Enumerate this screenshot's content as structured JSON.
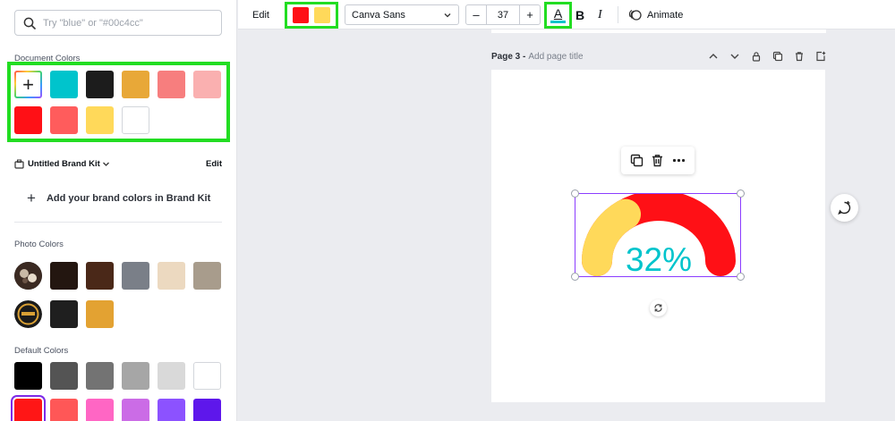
{
  "search": {
    "placeholder": "Try \"blue\" or \"#00c4cc\"",
    "icon": "search-icon"
  },
  "document_colors": {
    "title": "Document Colors",
    "add_icon": "plus-icon",
    "add_label": "+",
    "swatches": [
      "#00c4cc",
      "#1c1c1c",
      "#e8a838",
      "#f77e7e",
      "#fab0b0",
      "#ff1016",
      "#ff5c5c",
      "#ffd95a",
      "#ffffff"
    ]
  },
  "brand_kit": {
    "name": "Untitled Brand Kit",
    "dropdown_icon": "chevron-down-icon",
    "edit_label": "Edit",
    "add_label": "Add your brand colors in Brand Kit"
  },
  "photo_colors": {
    "title": "Photo Colors",
    "photos": [
      "photo-thumbnail-1",
      "photo-thumbnail-2"
    ],
    "row1": [
      "#231610",
      "#4a2818",
      "#7a7f88",
      "#ecd9c0",
      "#a89c8c"
    ],
    "row2": [
      "#1f1f1f",
      "#e3a232"
    ]
  },
  "default_colors": {
    "title": "Default Colors",
    "row1": [
      "#000000",
      "#545454",
      "#737373",
      "#a6a6a6",
      "#d9d9d9",
      "#ffffff"
    ],
    "row2": [
      "#ff1616",
      "#ff5757",
      "#ff66c4",
      "#cb6ce6",
      "#8c52ff",
      "#5e17eb"
    ]
  },
  "toolbar": {
    "edit_label": "Edit",
    "selected_colors": [
      "#ff1016",
      "#ffd95a"
    ],
    "font": "Canva Sans",
    "size_minus": "–",
    "size": "37",
    "size_plus": "+",
    "text_color_label": "A",
    "text_color": "#00c4cc",
    "bold_label": "B",
    "italic_label": "I",
    "animate_label": "Animate"
  },
  "page": {
    "title": "Page 3 -",
    "subtitle": "Add page title"
  },
  "gauge": {
    "value_text": "32%",
    "progress": 0.32,
    "track_color": "#ff1016",
    "fill_color": "#ffd95a",
    "text_color": "#00c4cc"
  }
}
